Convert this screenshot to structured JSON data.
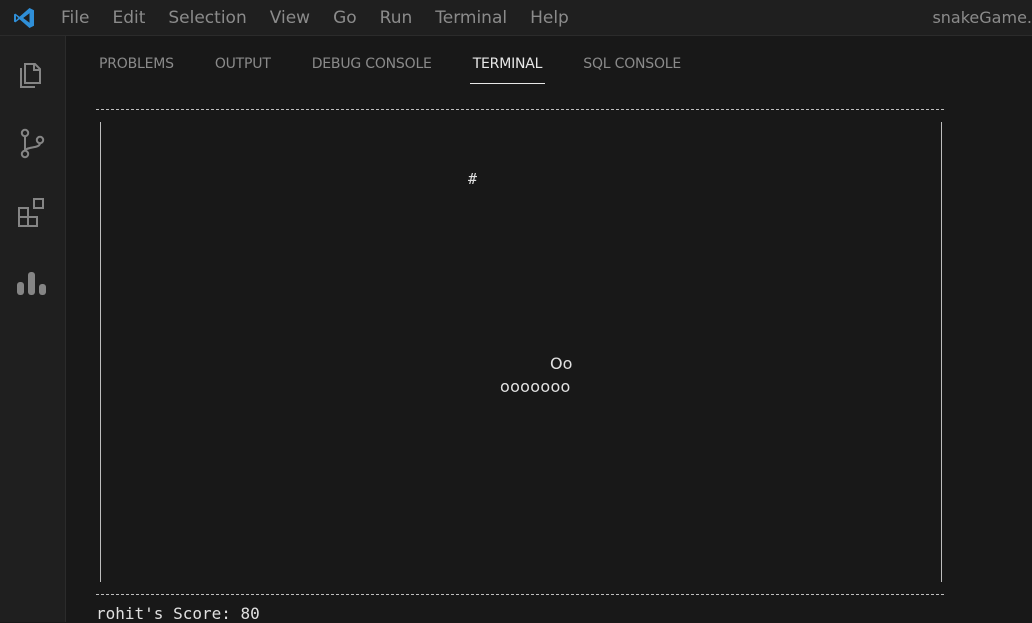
{
  "titlebar": {
    "menu": [
      "File",
      "Edit",
      "Selection",
      "View",
      "Go",
      "Run",
      "Terminal",
      "Help"
    ],
    "window_title": "snakeGame."
  },
  "activitybar": {
    "icons": [
      "explorer-icon",
      "source-control-icon",
      "extensions-icon",
      "charts-icon"
    ]
  },
  "panel": {
    "tabs": [
      "PROBLEMS",
      "OUTPUT",
      "DEBUG CONSOLE",
      "TERMINAL",
      "SQL CONSOLE"
    ],
    "active_tab": "TERMINAL"
  },
  "terminal": {
    "food": "#",
    "snake_head": "Oo",
    "snake_body": "ooooooo",
    "score_line": "rohit's Score: 80"
  },
  "colors": {
    "background": "#181818",
    "chrome": "#1f1f1f",
    "accent": "#2f8fd8"
  }
}
